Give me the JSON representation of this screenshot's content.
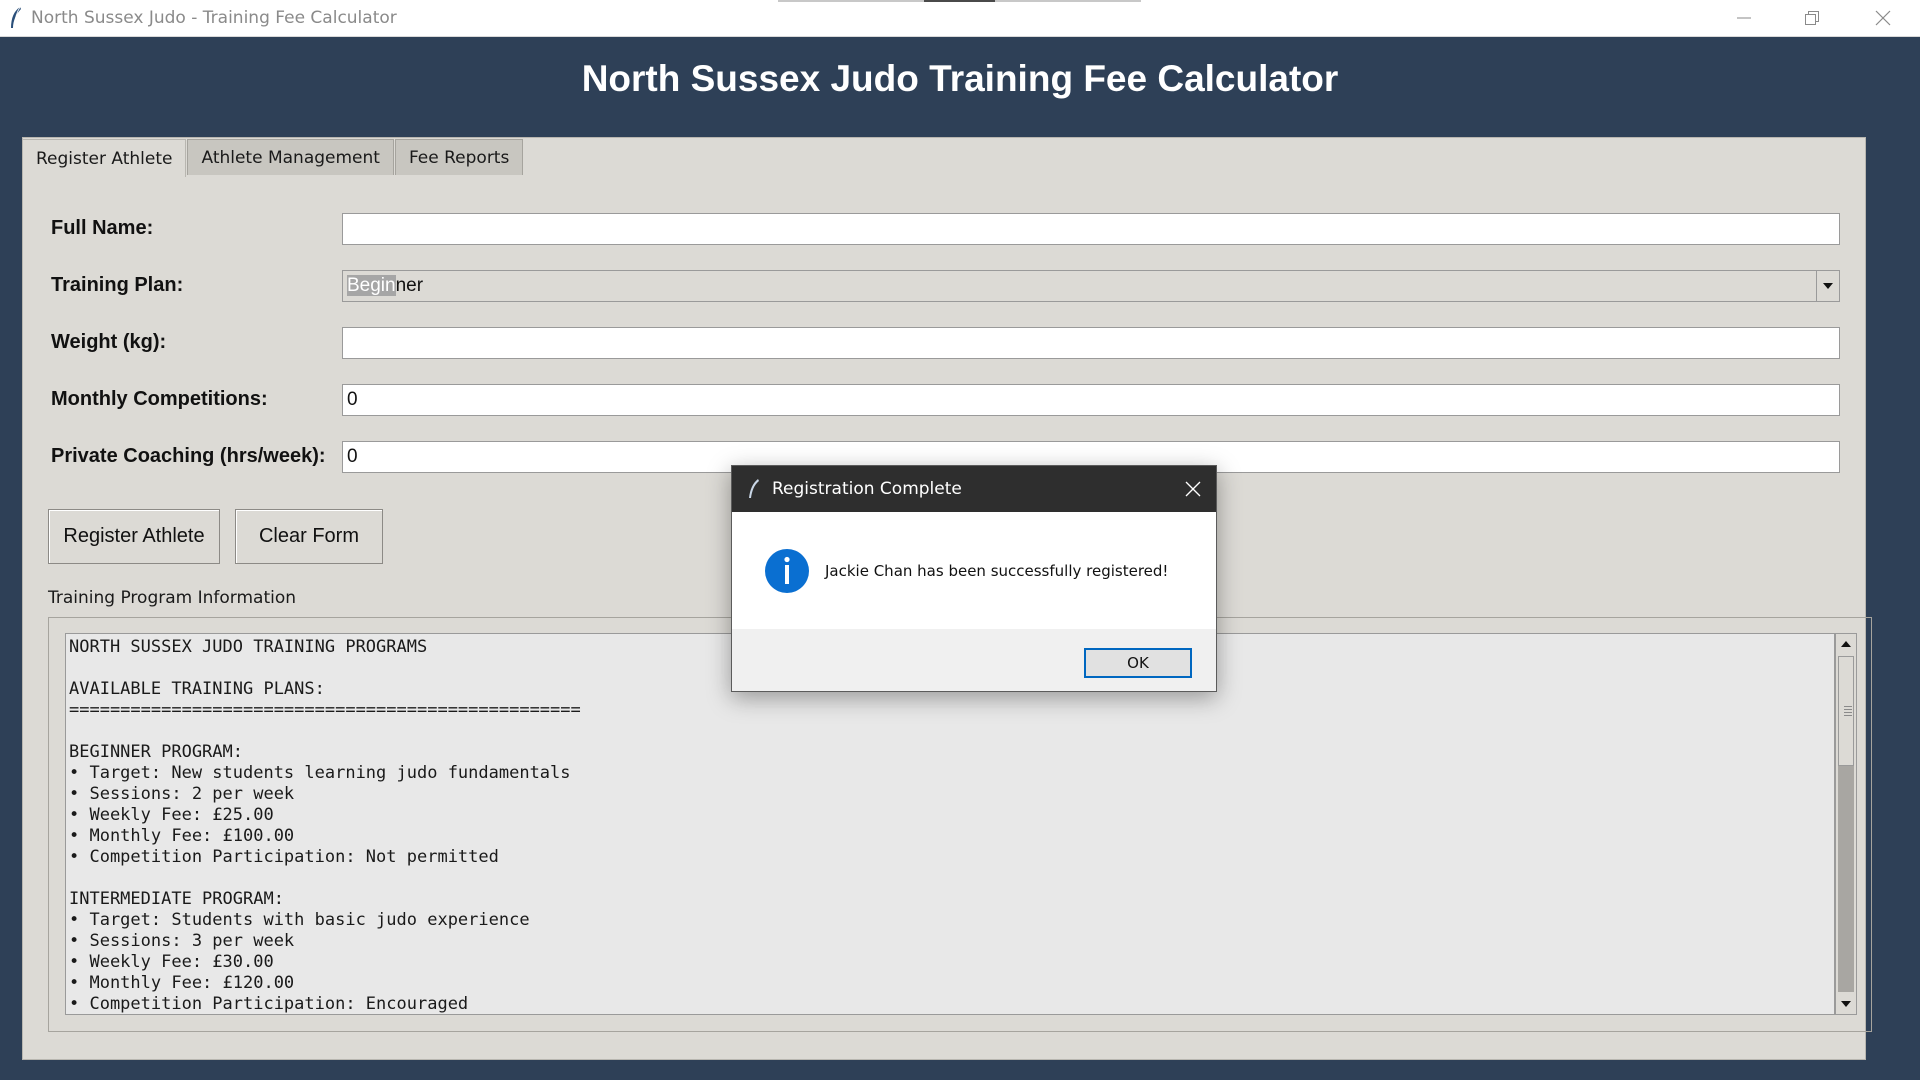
{
  "window": {
    "title": "North Sussex Judo - Training Fee Calculator"
  },
  "app": {
    "heading": "North Sussex Judo Training Fee Calculator"
  },
  "tabs": [
    {
      "label": "Register Athlete",
      "active": true
    },
    {
      "label": "Athlete Management",
      "active": false
    },
    {
      "label": "Fee Reports",
      "active": false
    }
  ],
  "form": {
    "full_name": {
      "label": "Full Name:",
      "value": ""
    },
    "training_plan": {
      "label": "Training Plan:",
      "value": "Beginner",
      "selected_part": "Begin",
      "rest_part": "ner"
    },
    "weight": {
      "label": "Weight (kg):",
      "value": ""
    },
    "monthly_competitions": {
      "label": "Monthly Competitions:",
      "value": "0"
    },
    "private_coaching": {
      "label": "Private Coaching (hrs/week):",
      "value": "0"
    }
  },
  "buttons": {
    "register": "Register Athlete",
    "clear": "Clear Form"
  },
  "info": {
    "section_label": "Training Program Information",
    "lines": [
      "NORTH SUSSEX JUDO TRAINING PROGRAMS",
      "",
      "AVAILABLE TRAINING PLANS:",
      "==================================================",
      "",
      "BEGINNER PROGRAM:",
      "• Target: New students learning judo fundamentals",
      "• Sessions: 2 per week",
      "• Weekly Fee: £25.00",
      "• Monthly Fee: £100.00",
      "• Competition Participation: Not permitted",
      "",
      "INTERMEDIATE PROGRAM:",
      "• Target: Students with basic judo experience",
      "• Sessions: 3 per week",
      "• Weekly Fee: £30.00",
      "• Monthly Fee: £120.00",
      "• Competition Participation: Encouraged"
    ]
  },
  "dialog": {
    "title": "Registration Complete",
    "message": "Jackie Chan has been successfully registered!",
    "ok_label": "OK",
    "icon": "info-icon"
  },
  "colors": {
    "app_background": "#2e4057",
    "panel": "#dcdad5",
    "dialog_accent": "#0067c0",
    "info_icon": "#0a6fd1"
  }
}
